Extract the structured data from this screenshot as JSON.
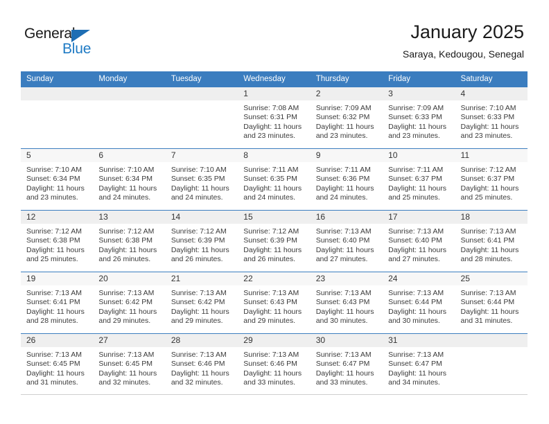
{
  "brand": {
    "name_part1": "General",
    "name_part2": "Blue",
    "logo_icon": "triangle-logo-icon",
    "color_dark": "#1a1a1a",
    "color_blue": "#1e7ac4"
  },
  "header": {
    "month_title": "January 2025",
    "location": "Saraya, Kedougou, Senegal"
  },
  "theme": {
    "header_band": "#3b7dbf",
    "daynum_band": "#f7f7f7",
    "daynum_band_shaded": "#efefef"
  },
  "weekdays": [
    "Sunday",
    "Monday",
    "Tuesday",
    "Wednesday",
    "Thursday",
    "Friday",
    "Saturday"
  ],
  "weeks": [
    [
      {
        "day": "",
        "empty": true,
        "sunrise": "",
        "sunset": "",
        "daylight1": "",
        "daylight2": ""
      },
      {
        "day": "",
        "empty": true,
        "sunrise": "",
        "sunset": "",
        "daylight1": "",
        "daylight2": ""
      },
      {
        "day": "",
        "empty": true,
        "sunrise": "",
        "sunset": "",
        "daylight1": "",
        "daylight2": ""
      },
      {
        "day": "1",
        "sunrise": "Sunrise: 7:08 AM",
        "sunset": "Sunset: 6:31 PM",
        "daylight1": "Daylight: 11 hours",
        "daylight2": "and 23 minutes."
      },
      {
        "day": "2",
        "sunrise": "Sunrise: 7:09 AM",
        "sunset": "Sunset: 6:32 PM",
        "daylight1": "Daylight: 11 hours",
        "daylight2": "and 23 minutes."
      },
      {
        "day": "3",
        "sunrise": "Sunrise: 7:09 AM",
        "sunset": "Sunset: 6:33 PM",
        "daylight1": "Daylight: 11 hours",
        "daylight2": "and 23 minutes."
      },
      {
        "day": "4",
        "sunrise": "Sunrise: 7:10 AM",
        "sunset": "Sunset: 6:33 PM",
        "daylight1": "Daylight: 11 hours",
        "daylight2": "and 23 minutes."
      }
    ],
    [
      {
        "day": "5",
        "sunrise": "Sunrise: 7:10 AM",
        "sunset": "Sunset: 6:34 PM",
        "daylight1": "Daylight: 11 hours",
        "daylight2": "and 23 minutes."
      },
      {
        "day": "6",
        "sunrise": "Sunrise: 7:10 AM",
        "sunset": "Sunset: 6:34 PM",
        "daylight1": "Daylight: 11 hours",
        "daylight2": "and 24 minutes."
      },
      {
        "day": "7",
        "sunrise": "Sunrise: 7:10 AM",
        "sunset": "Sunset: 6:35 PM",
        "daylight1": "Daylight: 11 hours",
        "daylight2": "and 24 minutes."
      },
      {
        "day": "8",
        "sunrise": "Sunrise: 7:11 AM",
        "sunset": "Sunset: 6:35 PM",
        "daylight1": "Daylight: 11 hours",
        "daylight2": "and 24 minutes."
      },
      {
        "day": "9",
        "sunrise": "Sunrise: 7:11 AM",
        "sunset": "Sunset: 6:36 PM",
        "daylight1": "Daylight: 11 hours",
        "daylight2": "and 24 minutes."
      },
      {
        "day": "10",
        "sunrise": "Sunrise: 7:11 AM",
        "sunset": "Sunset: 6:37 PM",
        "daylight1": "Daylight: 11 hours",
        "daylight2": "and 25 minutes."
      },
      {
        "day": "11",
        "sunrise": "Sunrise: 7:12 AM",
        "sunset": "Sunset: 6:37 PM",
        "daylight1": "Daylight: 11 hours",
        "daylight2": "and 25 minutes."
      }
    ],
    [
      {
        "day": "12",
        "sunrise": "Sunrise: 7:12 AM",
        "sunset": "Sunset: 6:38 PM",
        "daylight1": "Daylight: 11 hours",
        "daylight2": "and 25 minutes."
      },
      {
        "day": "13",
        "sunrise": "Sunrise: 7:12 AM",
        "sunset": "Sunset: 6:38 PM",
        "daylight1": "Daylight: 11 hours",
        "daylight2": "and 26 minutes."
      },
      {
        "day": "14",
        "sunrise": "Sunrise: 7:12 AM",
        "sunset": "Sunset: 6:39 PM",
        "daylight1": "Daylight: 11 hours",
        "daylight2": "and 26 minutes."
      },
      {
        "day": "15",
        "sunrise": "Sunrise: 7:12 AM",
        "sunset": "Sunset: 6:39 PM",
        "daylight1": "Daylight: 11 hours",
        "daylight2": "and 26 minutes."
      },
      {
        "day": "16",
        "sunrise": "Sunrise: 7:13 AM",
        "sunset": "Sunset: 6:40 PM",
        "daylight1": "Daylight: 11 hours",
        "daylight2": "and 27 minutes."
      },
      {
        "day": "17",
        "sunrise": "Sunrise: 7:13 AM",
        "sunset": "Sunset: 6:40 PM",
        "daylight1": "Daylight: 11 hours",
        "daylight2": "and 27 minutes."
      },
      {
        "day": "18",
        "sunrise": "Sunrise: 7:13 AM",
        "sunset": "Sunset: 6:41 PM",
        "daylight1": "Daylight: 11 hours",
        "daylight2": "and 28 minutes."
      }
    ],
    [
      {
        "day": "19",
        "sunrise": "Sunrise: 7:13 AM",
        "sunset": "Sunset: 6:41 PM",
        "daylight1": "Daylight: 11 hours",
        "daylight2": "and 28 minutes."
      },
      {
        "day": "20",
        "sunrise": "Sunrise: 7:13 AM",
        "sunset": "Sunset: 6:42 PM",
        "daylight1": "Daylight: 11 hours",
        "daylight2": "and 29 minutes."
      },
      {
        "day": "21",
        "sunrise": "Sunrise: 7:13 AM",
        "sunset": "Sunset: 6:42 PM",
        "daylight1": "Daylight: 11 hours",
        "daylight2": "and 29 minutes."
      },
      {
        "day": "22",
        "sunrise": "Sunrise: 7:13 AM",
        "sunset": "Sunset: 6:43 PM",
        "daylight1": "Daylight: 11 hours",
        "daylight2": "and 29 minutes."
      },
      {
        "day": "23",
        "sunrise": "Sunrise: 7:13 AM",
        "sunset": "Sunset: 6:43 PM",
        "daylight1": "Daylight: 11 hours",
        "daylight2": "and 30 minutes."
      },
      {
        "day": "24",
        "sunrise": "Sunrise: 7:13 AM",
        "sunset": "Sunset: 6:44 PM",
        "daylight1": "Daylight: 11 hours",
        "daylight2": "and 30 minutes."
      },
      {
        "day": "25",
        "sunrise": "Sunrise: 7:13 AM",
        "sunset": "Sunset: 6:44 PM",
        "daylight1": "Daylight: 11 hours",
        "daylight2": "and 31 minutes."
      }
    ],
    [
      {
        "day": "26",
        "sunrise": "Sunrise: 7:13 AM",
        "sunset": "Sunset: 6:45 PM",
        "daylight1": "Daylight: 11 hours",
        "daylight2": "and 31 minutes."
      },
      {
        "day": "27",
        "sunrise": "Sunrise: 7:13 AM",
        "sunset": "Sunset: 6:45 PM",
        "daylight1": "Daylight: 11 hours",
        "daylight2": "and 32 minutes."
      },
      {
        "day": "28",
        "sunrise": "Sunrise: 7:13 AM",
        "sunset": "Sunset: 6:46 PM",
        "daylight1": "Daylight: 11 hours",
        "daylight2": "and 32 minutes."
      },
      {
        "day": "29",
        "sunrise": "Sunrise: 7:13 AM",
        "sunset": "Sunset: 6:46 PM",
        "daylight1": "Daylight: 11 hours",
        "daylight2": "and 33 minutes."
      },
      {
        "day": "30",
        "sunrise": "Sunrise: 7:13 AM",
        "sunset": "Sunset: 6:47 PM",
        "daylight1": "Daylight: 11 hours",
        "daylight2": "and 33 minutes."
      },
      {
        "day": "31",
        "sunrise": "Sunrise: 7:13 AM",
        "sunset": "Sunset: 6:47 PM",
        "daylight1": "Daylight: 11 hours",
        "daylight2": "and 34 minutes."
      },
      {
        "day": "",
        "empty": true,
        "sunrise": "",
        "sunset": "",
        "daylight1": "",
        "daylight2": ""
      }
    ]
  ]
}
